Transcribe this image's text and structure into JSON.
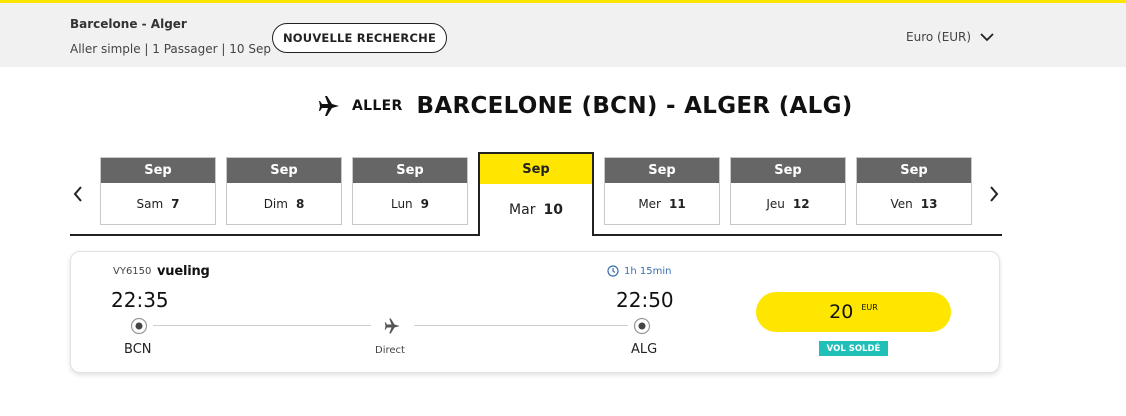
{
  "header": {
    "route": "Barcelone - Alger",
    "summary": "Aller simple | 1 Passager | 10 Sep",
    "new_search_label": "NOUVELLE RECHERCHE",
    "currency": "Euro (EUR)"
  },
  "direction": {
    "label": "ALLER",
    "title": "BARCELONE (BCN) - ALGER (ALG)",
    "icon": "plane-icon"
  },
  "dates": [
    {
      "month": "Sep",
      "weekday": "Sam",
      "day": "7"
    },
    {
      "month": "Sep",
      "weekday": "Dim",
      "day": "8"
    },
    {
      "month": "Sep",
      "weekday": "Lun",
      "day": "9"
    },
    {
      "month": "Sep",
      "weekday": "Mar",
      "day": "10",
      "selected": true
    },
    {
      "month": "Sep",
      "weekday": "Mer",
      "day": "11"
    },
    {
      "month": "Sep",
      "weekday": "Jeu",
      "day": "12"
    },
    {
      "month": "Sep",
      "weekday": "Ven",
      "day": "13"
    }
  ],
  "flight": {
    "number": "VY6150",
    "carrier": "vueling",
    "duration": "1h 15min",
    "departure_time": "22:35",
    "arrival_time": "22:50",
    "departure_airport": "BCN",
    "arrival_airport": "ALG",
    "stops": "Direct",
    "price": "20",
    "price_currency": "EUR",
    "badge": "VOL SOLDÉ"
  },
  "colors": {
    "accent": "#ffe600",
    "header_bg": "#f1f1f1",
    "date_header": "#666666",
    "badge": "#20c0b8",
    "duration": "#3a6fb0"
  }
}
